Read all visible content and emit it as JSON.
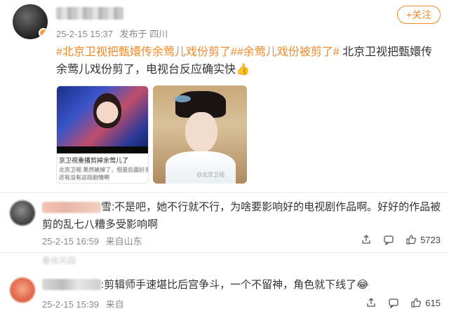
{
  "post": {
    "meta": {
      "time": "25-2-15 15:37",
      "source": "发布于 四川"
    },
    "follow_label": "+关注",
    "tag1": "#北京卫视把甄嬛传余莺儿戏份剪了#",
    "tag2": "#余莺儿戏份被剪了#",
    "body": " 北京卫视把甄嬛传余莺儿戏份剪了，电视台反应确实快",
    "emoji": "👍",
    "thumb1": {
      "caption": "京卫视重播剪掉余莺儿了",
      "caption2": "北京卫视  黑然被掉了，但是后面好多剧情都",
      "caption3": "还有没有这段剧情啊"
    },
    "thumb2": {
      "watermark": "@北京卫视"
    }
  },
  "comments": [
    {
      "name_suffix": "雪",
      "text": ":不是吧，她不行就不行，为啥要影响好的电视剧作品啊。好好的作品被剪的乱七八糟多受影响啊",
      "time": "25-2-15 16:59",
      "source": "来自山东",
      "likes": "5723"
    },
    {
      "faint_text": "春侯风园",
      "text": ":剪辑师手速堪比后宫争斗，一个不留神，角色就下线了",
      "emoji": "😂",
      "time": "25-2-15 15:39",
      "source": "来自",
      "likes": "615"
    }
  ],
  "icons": {
    "share": "share-icon",
    "comment": "comment-icon",
    "like": "thumbs-up-icon",
    "verified": "vip-badge-icon",
    "blur": "blurred-name"
  },
  "colors": {
    "accent": "#f08a2c",
    "meta": "#8a8a8a",
    "text": "#333333",
    "divider": "#ececec"
  }
}
